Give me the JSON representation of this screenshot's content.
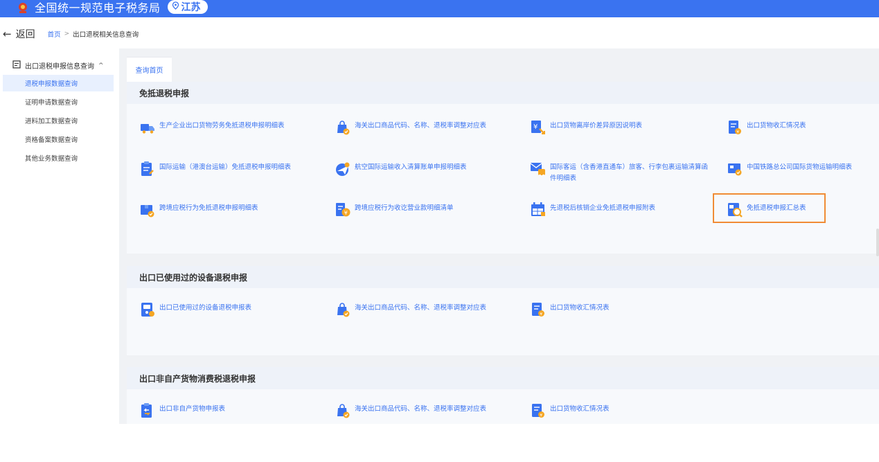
{
  "app": {
    "title": "全国统一规范电子税务局",
    "region": "江苏"
  },
  "nav": {
    "back_label": "返回",
    "breadcrumb": {
      "home": "首页",
      "separator": ">",
      "current": "出口退税相关信息查询"
    }
  },
  "sidebar": {
    "group_label": "出口退税申报信息查询",
    "items": [
      {
        "label": "退税申报数据查询",
        "active": true
      },
      {
        "label": "证明申请数据查询",
        "active": false
      },
      {
        "label": "进料加工数据查询",
        "active": false
      },
      {
        "label": "资格备案数据查询",
        "active": false
      },
      {
        "label": "其他业务数据查询",
        "active": false
      }
    ]
  },
  "main": {
    "tab_label": "查询首页",
    "sections": [
      {
        "title": "免抵退税申报",
        "items": [
          {
            "label": "生产企业出口货物劳务免抵退税申报明细表",
            "icon": "truck-icon"
          },
          {
            "label": "海关出口商品代码、名称、退税率调整对应表",
            "icon": "bag-check-icon"
          },
          {
            "label": "出口货物离岸价差异原因说明表",
            "icon": "yen-doc-icon"
          },
          {
            "label": "出口货物收汇情况表",
            "icon": "doc-coin-icon"
          },
          {
            "label": "国际运输（港澳台运输）免抵退税申报明细表",
            "icon": "clipboard-icon"
          },
          {
            "label": "航空国际运输收入清算账单申报明细表",
            "icon": "plane-icon"
          },
          {
            "label": "国际客运（含香港直通车）旅客、行李包裹运输清算函件明细表",
            "icon": "mail-bus-icon"
          },
          {
            "label": "中国铁路总公司国际货物运输明细表",
            "icon": "rail-check-icon"
          },
          {
            "label": "跨境应税行为免抵退税申报明细表",
            "icon": "box-check-icon"
          },
          {
            "label": "跨境应税行为收讫营业款明细清单",
            "icon": "doc-yen-icon"
          },
          {
            "label": "先退税后核销企业免抵退税申报附表",
            "icon": "calendar-table-icon"
          },
          {
            "label": "免抵退税申报汇总表",
            "icon": "search-doc-icon"
          }
        ]
      },
      {
        "title": "出口已使用过的设备退税申报",
        "items": [
          {
            "label": "出口已使用过的设备退税申报表",
            "icon": "device-icon"
          },
          {
            "label": "海关出口商品代码、名称、退税率调整对应表",
            "icon": "bag-check-icon"
          },
          {
            "label": "出口货物收汇情况表",
            "icon": "doc-coin-icon"
          }
        ]
      },
      {
        "title": "出口非自产货物消费税退税申报",
        "items": [
          {
            "label": "出口非自产货物申报表",
            "icon": "return-doc-icon"
          },
          {
            "label": "海关出口商品代码、名称、退税率调整对应表",
            "icon": "bag-check-icon"
          },
          {
            "label": "出口货物收汇情况表",
            "icon": "doc-coin-icon"
          }
        ]
      }
    ]
  },
  "colors": {
    "primary": "#3a73f0",
    "icon_accent": "#f5a623",
    "highlight": "#f08c35",
    "page_bg": "#f0f2f5"
  }
}
